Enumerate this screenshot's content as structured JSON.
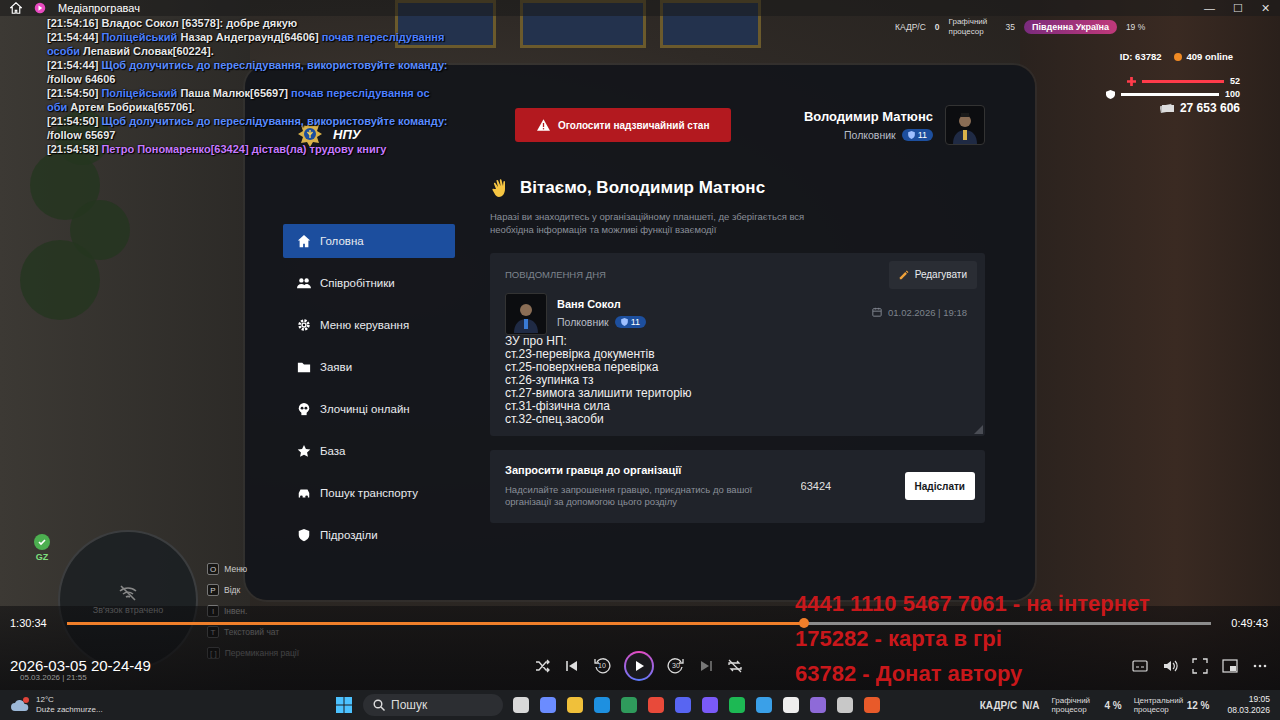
{
  "player": {
    "title": "Медіапрогравач",
    "window_controls": [
      "—",
      "☐",
      "✕"
    ],
    "elapsed": "1:30:34",
    "remaining": "0:49:43",
    "level": 0.644,
    "file_name": "2026-03-05 20-24-49",
    "playing": false,
    "skip_back": "10",
    "skip_forward": "30"
  },
  "chat": [
    [
      {
        "text": "[21:54:16] Владос Сокол [63578]: добре дякую",
        "color": "#e8e8e8"
      }
    ],
    [
      {
        "text": "[21:54:44] ",
        "color": "#e8e8e8"
      },
      {
        "text": "Поліцейський ",
        "color": "#4d80ff"
      },
      {
        "text": "Назар Андеграунд[64606] ",
        "color": "#e8e8e8"
      },
      {
        "text": "почав переслідування",
        "color": "#4d80ff"
      }
    ],
    [
      {
        "text": "особи ",
        "color": "#4d80ff"
      },
      {
        "text": "Лепавий Словак[60224].",
        "color": "#e8e8e8"
      }
    ],
    [
      {
        "text": "[21:54:44] ",
        "color": "#e8e8e8"
      },
      {
        "text": "Щоб долучитись до переслідування, використовуйте команду:",
        "color": "#5a8cff"
      }
    ],
    [
      {
        "text": "/follow 64606",
        "color": "#e8e8e8"
      }
    ],
    [
      {
        "text": "[21:54:50] ",
        "color": "#e8e8e8"
      },
      {
        "text": "Поліцейський ",
        "color": "#4d80ff"
      },
      {
        "text": "Паша Малюк[65697] ",
        "color": "#e8e8e8"
      },
      {
        "text": "почав переслідування ос",
        "color": "#4d80ff"
      }
    ],
    [
      {
        "text": "оби ",
        "color": "#4d80ff"
      },
      {
        "text": "Артем Бобрика[65706].",
        "color": "#e8e8e8"
      }
    ],
    [
      {
        "text": "[21:54:50] ",
        "color": "#e8e8e8"
      },
      {
        "text": "Щоб долучитись до переслідування, використовуйте команду:",
        "color": "#5a8cff"
      }
    ],
    [
      {
        "text": "/follow 65697",
        "color": "#e8e8e8"
      }
    ],
    [
      {
        "text": "[21:54:58] ",
        "color": "#e8e8e8"
      },
      {
        "text": "Петро Пономаренко[63424] дістав(ла) трудову книгу",
        "color": "#c77bff"
      }
    ]
  ],
  "hud": {
    "fps_label": "КАДР/С",
    "fps": "0",
    "gpu_label": "Графічний процесор",
    "stat": "35",
    "region": "Південна Україна",
    "cpu": "19 %",
    "id": "ID: 63782",
    "online": "409 online",
    "health": "52",
    "health_level": 1,
    "armor": "100",
    "armor_level": 1,
    "money": "27 653 606"
  },
  "tablet": {
    "logo": "НПУ",
    "emergency_button": "Оголосити надзвичайний стан",
    "user": {
      "name": "Володимир Матюнс",
      "rank": "Полковник",
      "level": "11"
    },
    "greeting": "Вітаємо, Володимир Матюнс",
    "subtitle": "Наразі ви знаходитесь у організаційному планшеті, де зберігається вся необхідна інформація та можливі функції взаємодії",
    "sidebar": [
      {
        "label": "Головна",
        "selected": true
      },
      {
        "label": "Співробітники",
        "selected": false
      },
      {
        "label": "Меню керування",
        "selected": false
      },
      {
        "label": "Заяви",
        "selected": false
      },
      {
        "label": "Злочинці онлайн",
        "selected": false
      },
      {
        "label": "База",
        "selected": false
      },
      {
        "label": "Пошук транспорту",
        "selected": false
      },
      {
        "label": "Підрозділи",
        "selected": false
      }
    ],
    "motd": {
      "title": "ПОВІДОМЛЕННЯ ДНЯ",
      "edit": "Редагувати",
      "author": "Ваня Сокол",
      "rank": "Полковник",
      "level": "11",
      "date": "01.02.2026 | 19:18",
      "lines": [
        "ЗУ про НП:",
        "ст.23-перевірка документів",
        "ст.25-поверхнева перевірка",
        "ст.26-зупинка тз",
        "ст.27-вимога залишити територію",
        "ст.31-фізична сила",
        "ст.32-спец.засоби"
      ]
    },
    "invite": {
      "title": "Запросити гравця до організації",
      "description": "Надсилайте запрошення гравцю, приєднатись до вашої організації за допомогою цього розділу",
      "value": "63424",
      "button": "Надіслати"
    }
  },
  "bottom_hud": {
    "badge": "GZ",
    "minimap": "Зв'язок втрачено",
    "keys": [
      {
        "key": "O",
        "label": "Меню"
      },
      {
        "key": "P",
        "label": "Відк"
      },
      {
        "key": "I",
        "label": "Інвен."
      },
      {
        "key": "T",
        "label": "Текстовий чат"
      },
      {
        "key": "[ ]",
        "label": "Перемикання рації"
      }
    ],
    "datetime": "05.03.2026 | 21:55"
  },
  "stream_overlay": [
    "4441 1110 5467 7061 - на інтернет",
    "175282 - карта в грі",
    "63782 - Донат автору"
  ],
  "taskbar": {
    "temperature": "12°C",
    "weather": "Duże zachmurze...",
    "search": "Пошук",
    "stats": [
      {
        "label": "КАДР/С",
        "value": "N/A"
      },
      {
        "label": "Графічний процесор",
        "value": "4 %"
      },
      {
        "label": "Центральний процесор",
        "value": "12 %"
      }
    ],
    "time": "19:05",
    "date": "08.03.2026"
  }
}
